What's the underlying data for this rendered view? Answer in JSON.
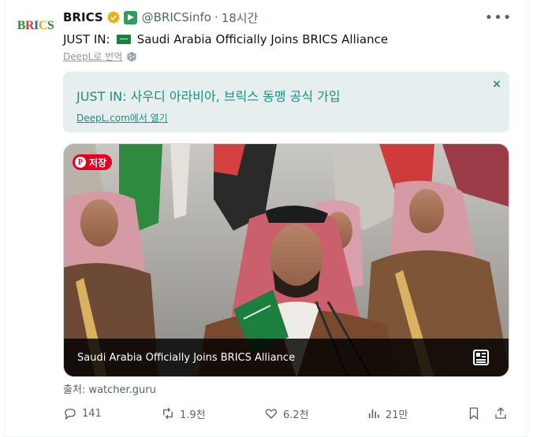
{
  "author": {
    "name": "BRICS",
    "handle": "@BRICSinfo",
    "separator": "·",
    "time": "18시간",
    "avatar_text": [
      "B",
      "R",
      "I",
      "C",
      "S"
    ]
  },
  "tweet": {
    "prefix": "JUST IN:",
    "body": "Saudi Arabia Officially Joins BRICS Alliance",
    "translate_label": "DeepL로 번역"
  },
  "translation": {
    "text": "JUST IN:  사우디 아라비아, 브릭스 동맹 공식 가입",
    "link": "DeepL.com에서 열기",
    "close": "×"
  },
  "card": {
    "pin_label": "저장",
    "title": "Saudi Arabia Officially Joins BRICS Alliance"
  },
  "source": "출처: watcher.guru",
  "actions": {
    "replies": "141",
    "retweets": "1.9천",
    "likes": "6.2천",
    "views": "21만"
  },
  "colors": {
    "accent": "#1b8e7e",
    "pinterest": "#e60023",
    "verified_gold": "#e8b20e",
    "muted": "#536471"
  }
}
